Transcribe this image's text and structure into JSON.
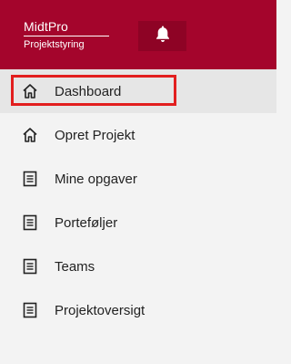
{
  "header": {
    "brand_name": "MidtPro",
    "brand_sub": "Projektstyring",
    "notification_icon": "bell-icon",
    "bg_color": "#a4052c"
  },
  "menu": {
    "items": [
      {
        "label": "Dashboard",
        "icon": "home-icon",
        "active": true
      },
      {
        "label": "Opret Projekt",
        "icon": "home-icon",
        "active": false
      },
      {
        "label": "Mine opgaver",
        "icon": "document-list-icon",
        "active": false
      },
      {
        "label": "Porteføljer",
        "icon": "document-list-icon",
        "active": false
      },
      {
        "label": "Teams",
        "icon": "document-list-icon",
        "active": false
      },
      {
        "label": "Projektoversigt",
        "icon": "document-list-icon",
        "active": false
      }
    ]
  },
  "highlight_color": "#e21f1f"
}
